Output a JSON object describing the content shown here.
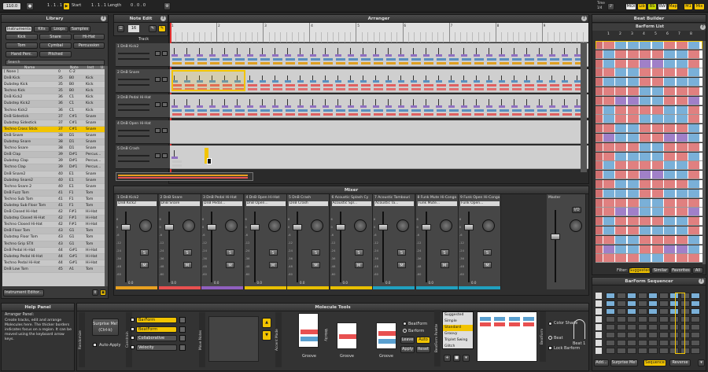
{
  "transport": {
    "tempo": "110.0",
    "position": "1 . 1 . 1",
    "start_label": "Start",
    "start_value": "1 . 1 . 1",
    "length_label": "Length",
    "length_value": "0 . 0 . 0",
    "time_label": "Time",
    "time_value": "1/4",
    "midi": "MIDI",
    "lib": "Lib",
    "bs": "BS",
    "bw": "BW",
    "map": "Map",
    "m1": "M1",
    "mix": "Mix"
  },
  "library": {
    "title": "Library",
    "tabs": [
      "Instruments",
      "Kits",
      "Loops",
      "Samples"
    ],
    "filters": [
      "Kick",
      "Snare",
      "Hi-Hat",
      "Tom",
      "Cymbal",
      "Percussion",
      "Hand Perc.",
      "Pitched"
    ],
    "search": "Search",
    "columns": [
      "Name",
      "Note",
      "Inst",
      "U"
    ],
    "rows": [
      [
        "[ None ]",
        "0",
        "C-2",
        ""
      ],
      [
        "DnB Kick",
        "35",
        "B0",
        "Kick"
      ],
      [
        "Dubstep Kick",
        "35",
        "B0",
        "Kick"
      ],
      [
        "Techno Kick",
        "35",
        "B0",
        "Kick"
      ],
      [
        "DnB Kick2",
        "36",
        "C1",
        "Kick"
      ],
      [
        "Dubstep Kick2",
        "36",
        "C1",
        "Kick"
      ],
      [
        "Techno Kick2",
        "36",
        "C1",
        "Kick"
      ],
      [
        "DnB Sidestick",
        "37",
        "C#1",
        "Snare"
      ],
      [
        "Dubstep Sidestick",
        "37",
        "C#1",
        "Snare"
      ],
      [
        "Techno Cross Stick",
        "37",
        "C#1",
        "Snare"
      ],
      [
        "DnB Snare",
        "38",
        "D1",
        "Snare"
      ],
      [
        "Dubstep Snare",
        "38",
        "D1",
        "Snare"
      ],
      [
        "Techno Snare",
        "38",
        "D1",
        "Snare"
      ],
      [
        "DnB Clap",
        "39",
        "D#1",
        "Percus..."
      ],
      [
        "Dubstep Clap",
        "39",
        "D#1",
        "Percus..."
      ],
      [
        "Techno Clap",
        "39",
        "D#1",
        "Percus..."
      ],
      [
        "DnB Snare2",
        "40",
        "E1",
        "Snare"
      ],
      [
        "Dubstep Snare2",
        "40",
        "E1",
        "Snare"
      ],
      [
        "Techno Snare 2",
        "40",
        "E1",
        "Snare"
      ],
      [
        "DnB Fuzz Tom",
        "41",
        "F1",
        "Tom"
      ],
      [
        "Techno Sub Tom",
        "41",
        "F1",
        "Tom"
      ],
      [
        "Dubstep Sub Floor Tom",
        "41",
        "F1",
        "Tom"
      ],
      [
        "DnB Closed Hi-Hat",
        "42",
        "F#1",
        "Hi-Hat"
      ],
      [
        "Dubstep Closed Hi-Hat",
        "42",
        "F#1",
        "Hi-Hat"
      ],
      [
        "Techno Closed Hi-Hat",
        "42",
        "F#1",
        "Hi-Hat"
      ],
      [
        "DnB Floor Tom",
        "43",
        "G1",
        "Tom"
      ],
      [
        "Dubstep Floor Tom",
        "43",
        "G1",
        "Tom"
      ],
      [
        "Techno Grip STX",
        "43",
        "G1",
        "Tom"
      ],
      [
        "DnB Pedal Hi-Hat",
        "44",
        "G#1",
        "Hi-Hat"
      ],
      [
        "Dubstep Pedal Hi-Hat",
        "44",
        "G#1",
        "Hi-Hat"
      ],
      [
        "Techno Pedal Hi-Hat",
        "44",
        "G#1",
        "Hi-Hat"
      ],
      [
        "DnB Low Tom",
        "45",
        "A1",
        "Tom"
      ]
    ],
    "highlight_index": 9,
    "editor_label": "Instrument Editor..."
  },
  "help": {
    "title": "Help Panel",
    "heading": "Arranger Panel:",
    "body": "Create tracks, edit and arrange Molecules here. The thicker borders indicates focus on a region. It can be moved using the keyboard arrow keys."
  },
  "note_edit": {
    "title": "Note Edit",
    "value": "16",
    "track_header": "Track"
  },
  "arranger": {
    "title": "Arranger",
    "bar_numbers": [
      "1",
      "2",
      "3",
      "4",
      "5",
      "6",
      "7",
      "8",
      "9"
    ],
    "tracks": [
      "1 DnB Kick2",
      "2 DnB Snare",
      "3 DnB Pedal Hi-Hat",
      "4 DnB Open Hi-Hat",
      "5 DnB Crash"
    ]
  },
  "mixer": {
    "title": "Mixer",
    "channels": [
      {
        "name": "1 DnB Kick2",
        "inst": "DnB Kick2",
        "color": "#e8a020"
      },
      {
        "name": "2 DnB Snare",
        "inst": "DnB Snare",
        "color": "#e85050"
      },
      {
        "name": "3 DnB Pedal Hi-Hat",
        "inst": "DnB Pedal...",
        "color": "#9060c0"
      },
      {
        "name": "4 DnB Open Hi-Hat",
        "inst": "DnB Open...",
        "color": "#e8c000"
      },
      {
        "name": "5 DnB Crash",
        "inst": "DnB Crash",
        "color": "#e8c000"
      },
      {
        "name": "6 Acoustic Splash Cy",
        "inst": "Acoustic Spl...",
        "color": "#e8c000"
      },
      {
        "name": "7 Acoustic Tambouri",
        "inst": "Acoustic Ta...",
        "color": "#20a0c0"
      },
      {
        "name": "8 Funk Mute Hi-Conga",
        "inst": "Funk Mute...",
        "color": "#20a0c0"
      },
      {
        "name": "9 Funk Open Hi-Conga",
        "inst": "Funk Open...",
        "color": "#20a0c0"
      }
    ],
    "master": "Master",
    "io": "I/O",
    "mute": "M",
    "solo": "S",
    "db_value": "0.0",
    "scale": [
      "6",
      "0",
      "-6",
      "-12",
      "-24",
      "-36",
      "-48",
      "-60"
    ]
  },
  "beat_builder": {
    "title": "Beat Builder",
    "list_title": "BarForm List",
    "columns": [
      "1",
      "2",
      "3",
      "4",
      "5",
      "6",
      "7",
      "8"
    ],
    "filter_label": "Filter:",
    "filter_buttons": [
      "Suggested",
      "Similar",
      "Favorites",
      "All"
    ],
    "seq_title": "BarForm Sequencer",
    "seq_buttons": [
      "Add...",
      "Surprise Me!",
      "Sequence",
      "Reverse"
    ]
  },
  "molecule": {
    "title": "Molecule Tools",
    "surprise": "Surprise Me! (Ctrl-k)",
    "auto_apply": "Auto-Apply",
    "randomize": "Randomize",
    "side_labels": [
      "Randomize",
      "Constrain",
      "Move Notes",
      "Accent Mode"
    ],
    "constraints": [
      "BarForm",
      "BeatForm",
      "Collaborative",
      "Velocity"
    ],
    "beatform": "BeatForm",
    "barform": "Barform",
    "leave": "Leave",
    "auto": "Auto",
    "apply": "Apply",
    "reset": "Reset",
    "groove": "Groove",
    "velocity": "Velocity",
    "palette_title": "BeatForm Palette",
    "palette_items": [
      "Suggested",
      "Simple",
      "Standard",
      "Groovy",
      "Triplet Swing",
      "Glitch"
    ],
    "palette_selected": 2,
    "color_shade": "Color Shade",
    "beat": "Beat",
    "lock_barform": "Lock Barform",
    "beat_label": "Beat 1"
  }
}
